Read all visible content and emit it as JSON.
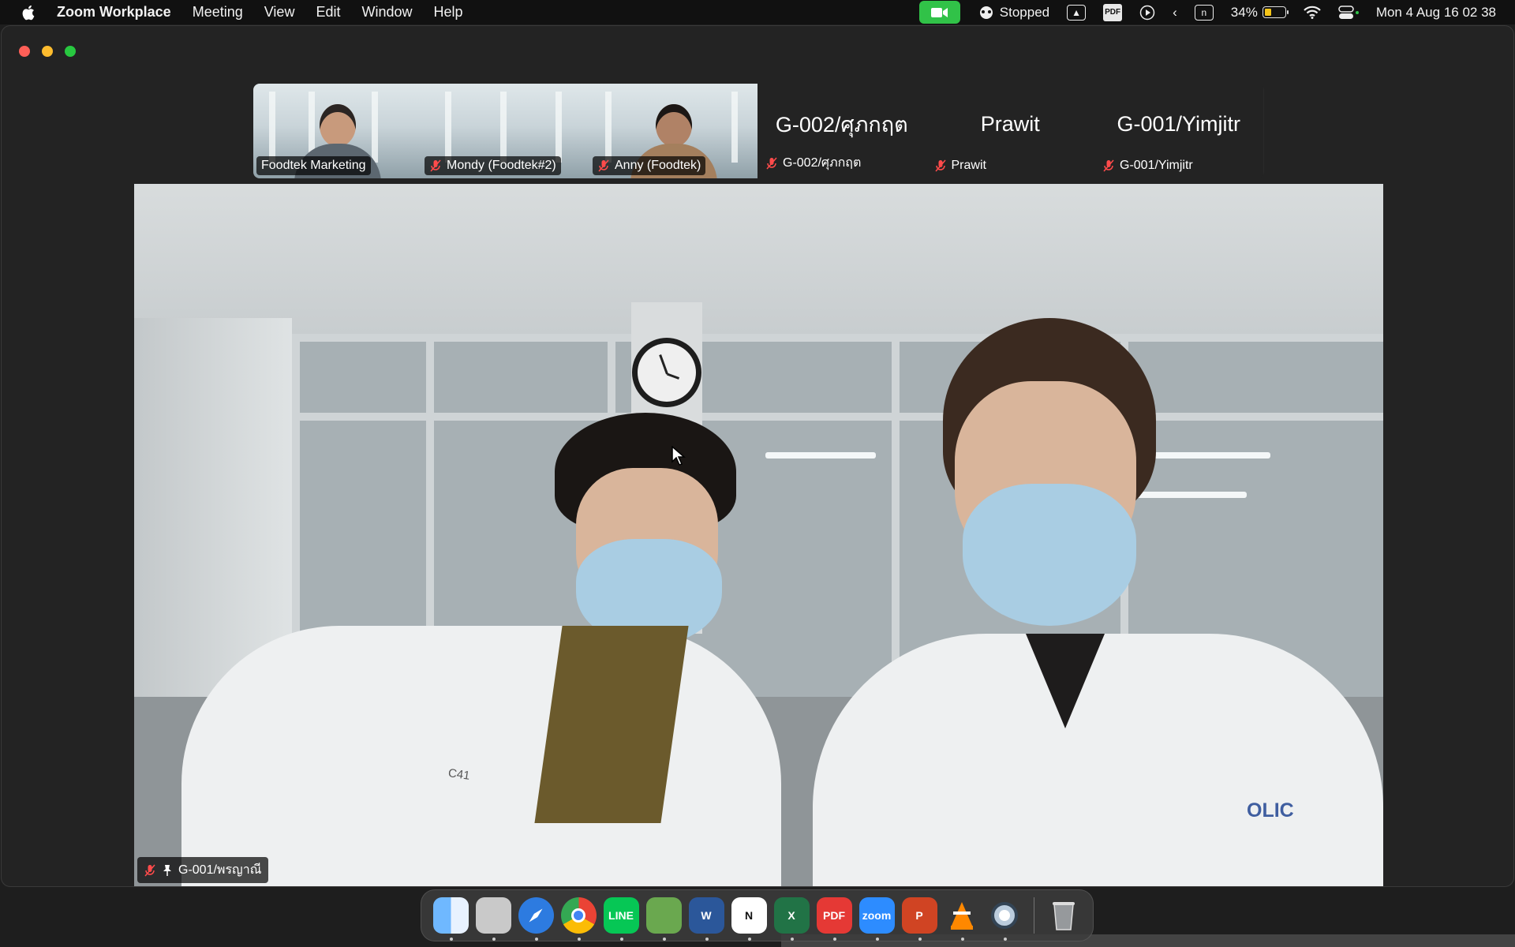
{
  "menubar": {
    "app_name": "Zoom Workplace",
    "menus": [
      "Meeting",
      "View",
      "Edit",
      "Window",
      "Help"
    ],
    "recording_status": "Stopped",
    "input_letter": "n",
    "battery": "34%",
    "datetime": "Mon 4 Aug  16 02 38"
  },
  "gallery": {
    "tiles": [
      {
        "label": "Foodtek Marketing",
        "muted": false,
        "type": "video"
      },
      {
        "label": "Mondy (Foodtek#2)",
        "muted": true,
        "type": "video"
      },
      {
        "label": "Anny (Foodtek)",
        "muted": true,
        "type": "video"
      },
      {
        "display_name": "G-002/ศุภกฤต",
        "label": "G-002/ศุภกฤต",
        "muted": true,
        "type": "name"
      },
      {
        "display_name": "Prawit",
        "label": "Prawit",
        "muted": true,
        "type": "name"
      },
      {
        "display_name": "G-001/Yimjitr",
        "label": "G-001/Yimjitr",
        "muted": true,
        "type": "name"
      }
    ]
  },
  "speaker": {
    "label": "G-001/พรญาณี",
    "coat_text_left": "C41",
    "coat_text_right": "OLIC"
  },
  "dock": {
    "apps": [
      {
        "name": "finder-icon",
        "color": "#3b8ff0",
        "text": ""
      },
      {
        "name": "launchpad-icon",
        "color": "#c9c9c9",
        "text": ""
      },
      {
        "name": "safari-icon",
        "color": "#2d7be0",
        "text": ""
      },
      {
        "name": "chrome-icon",
        "color": "#ffffff",
        "text": ""
      },
      {
        "name": "line-icon",
        "color": "#06c755",
        "text": "LINE"
      },
      {
        "name": "maps-icon",
        "color": "#6aa84f",
        "text": ""
      },
      {
        "name": "word-icon",
        "color": "#2b579a",
        "text": "W"
      },
      {
        "name": "notion-icon",
        "color": "#ffffff",
        "text": "N"
      },
      {
        "name": "excel-icon",
        "color": "#217346",
        "text": "X"
      },
      {
        "name": "pdf-expert-icon",
        "color": "#e53935",
        "text": "PDF"
      },
      {
        "name": "zoom-icon",
        "color": "#2d8cff",
        "text": "zoom"
      },
      {
        "name": "powerpoint-icon",
        "color": "#d04423",
        "text": "P"
      },
      {
        "name": "vlc-icon",
        "color": "#3a3a3a",
        "text": ""
      },
      {
        "name": "quicktime-icon",
        "color": "#4a4a4a",
        "text": ""
      }
    ],
    "trash": {
      "name": "trash-icon"
    }
  }
}
